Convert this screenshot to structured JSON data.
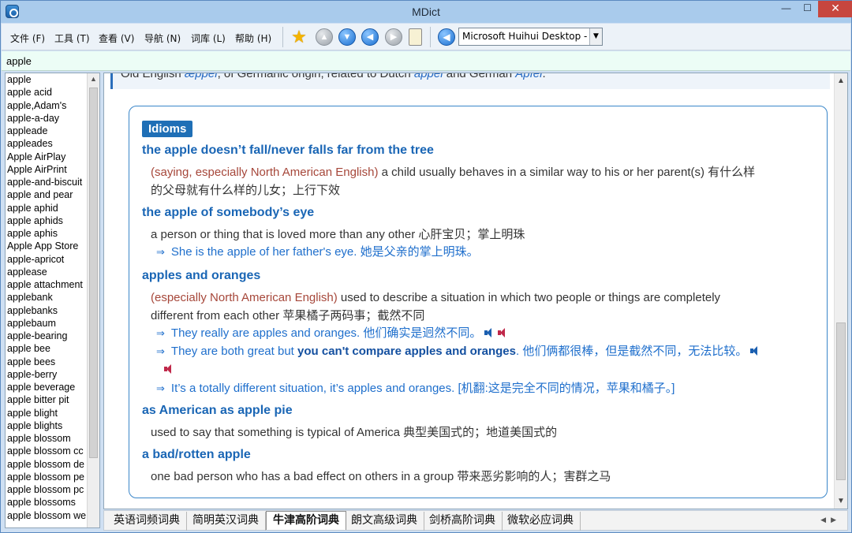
{
  "window": {
    "title": "MDict",
    "minimize": "—",
    "maximize": "☐",
    "close": "✕"
  },
  "menu": [
    "文件 (F)",
    "工具 (T)",
    "查看 (V)",
    "导航 (N)",
    "词库 (L)",
    "帮助 (H)"
  ],
  "toolbar": {
    "font_select_value": "Microsoft Huihui Desktop - C"
  },
  "search": {
    "value": "apple"
  },
  "wordlist": {
    "selected": "apple",
    "items": [
      "apple",
      "apple acid",
      "apple,Adam's",
      "apple-a-day",
      "appleade",
      "appleades",
      "Apple AirPlay",
      "Apple AirPrint",
      "apple-and-biscuit",
      "apple and pear",
      "apple aphid",
      "apple aphids",
      "apple aphis",
      "Apple App Store",
      "apple-apricot",
      "applease",
      "apple attachment",
      "applebank",
      "applebanks",
      "applebaum",
      "apple-bearing",
      "apple bee",
      "apple bees",
      "apple-berry",
      "apple beverage",
      "apple bitter pit",
      "apple blight",
      "apple blights",
      "apple blossom",
      "apple blossom cc",
      "apple blossom de",
      "apple blossom pe",
      "apple blossom pc",
      "apple blossoms",
      "apple blossom we"
    ]
  },
  "content": {
    "etymology": {
      "prefix": "Old English ",
      "w1": "æppel",
      "mid": ", of Germanic origin; related to Dutch ",
      "w2": "appel",
      "mid2": " and German ",
      "w3": "Apfel",
      "end": "."
    },
    "idioms_label": "Idioms",
    "idioms": [
      {
        "head": "the apple doesn’t fall/never falls far from the tree",
        "label": "(saying, especially North American English)",
        "def_line1": " a child usually behaves in a similar way to his or her parent(s) 有什么样",
        "def_line2": "的父母就有什么样的儿女；上行下效"
      },
      {
        "head": "the apple of somebody’s eye",
        "def": "a person or thing that is loved more than any other 心肝宝贝；掌上明珠",
        "example": "She is the apple of her father's eye. 她是父亲的掌上明珠。"
      },
      {
        "head": "apples and oranges",
        "label": "(especially North American English)",
        "def_line1": " used to describe a situation in which two people or things are completely",
        "def_line2": "different from each other 苹果橘子两码事；截然不同",
        "ex1": "They really are apples and oranges. 他们确实是迥然不同。",
        "ex2_pre": "They are both great but ",
        "ex2_bold": "you can't compare apples and oranges",
        "ex2_post": ". 他们俩都很棒，但是截然不同，无法比较。",
        "ex3": "It’s a totally different situation, it’s apples and oranges. [机翻:这是完全不同的情况，苹果和橘子。]"
      },
      {
        "head": "as American as apple pie",
        "def": "used to say that something is typical of America 典型美国式的；地道美国式的"
      },
      {
        "head": "a bad/rotten apple",
        "def": "one bad person who has a bad effect on others in a group 带来恶劣影响的人；害群之马"
      }
    ],
    "example_arrow": "⇒"
  },
  "tabs": [
    "英语词频词典",
    "简明英汉词典",
    "牛津高阶词典",
    "朗文高级词典",
    "剑桥高阶词典",
    "微软必应词典"
  ],
  "active_tab": "牛津高阶词典",
  "icons": [
    "app-icon",
    "favorite-star-icon",
    "history-up-icon",
    "history-down-icon",
    "back-icon",
    "forward-icon",
    "clipboard-icon",
    "speak-icon"
  ]
}
